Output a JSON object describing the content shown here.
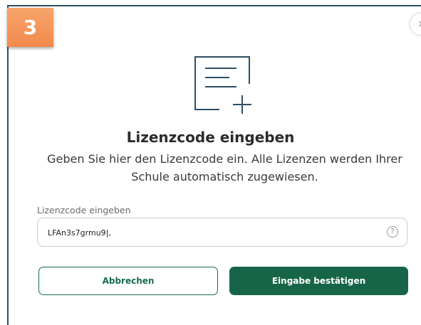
{
  "step": {
    "number": "3"
  },
  "dialog": {
    "close_glyph": "×",
    "icon": "add-document-icon",
    "title": "Lizenzcode eingeben",
    "subtitle": "Geben Sie hier den Lizenzcode ein. Alle Lizenzen werden Ihrer Schule automatisch zugewiesen.",
    "field": {
      "label": "Lizenzcode eingeben",
      "value": "LFAn3s7grmu9|,",
      "help_glyph": "?"
    },
    "buttons": {
      "cancel_label": "Abbrechen",
      "confirm_label": "Eingabe bestätigen"
    }
  },
  "colors": {
    "accent": "#176548",
    "badge": "#f28a4d",
    "icon_stroke": "#2f4f63"
  }
}
